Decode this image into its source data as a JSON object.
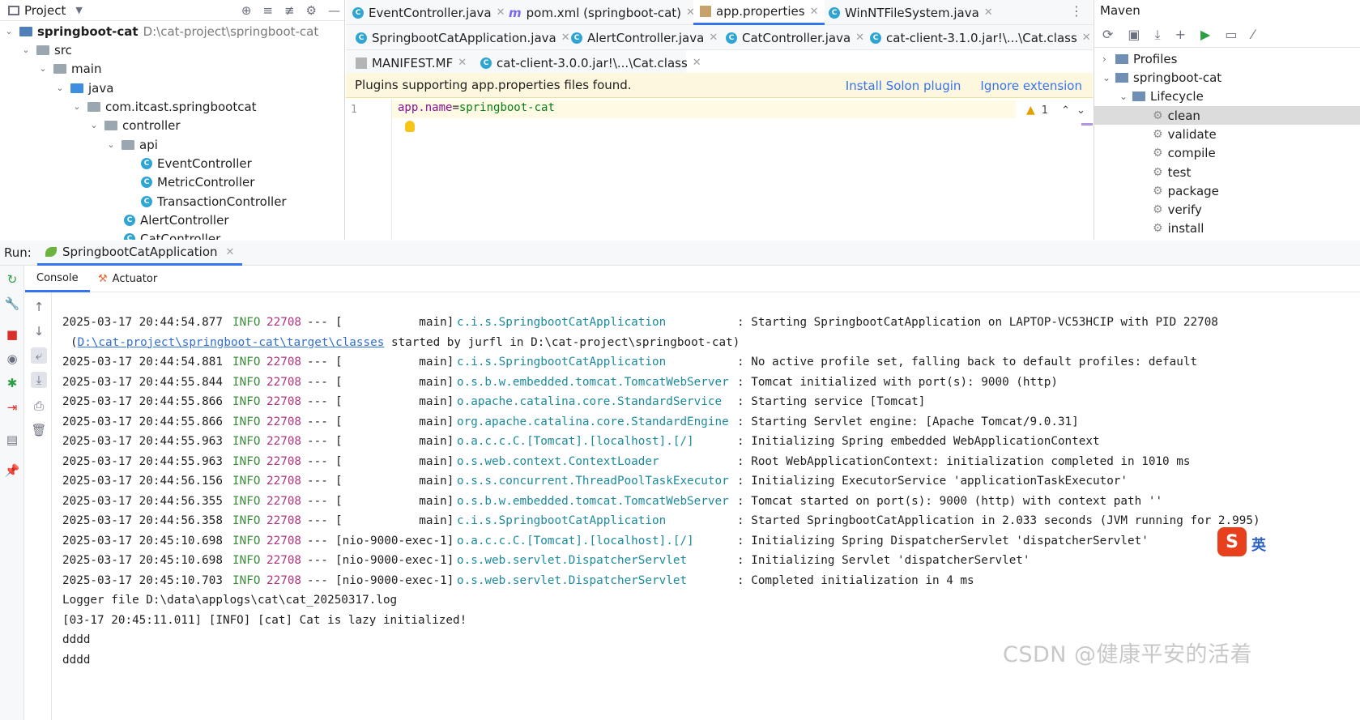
{
  "project": {
    "title": "Project",
    "tree": [
      {
        "label": "springboot-cat",
        "path": "D:\\cat-project\\springboot-cat"
      },
      {
        "label": "src"
      },
      {
        "label": "main"
      },
      {
        "label": "java"
      },
      {
        "label": "com.itcast.springbootcat"
      },
      {
        "label": "controller"
      },
      {
        "label": "api"
      },
      {
        "label": "EventController"
      },
      {
        "label": "MetricController"
      },
      {
        "label": "TransactionController"
      },
      {
        "label": "AlertController"
      },
      {
        "label": "CatController"
      }
    ]
  },
  "editor": {
    "tabs_row1": [
      {
        "label": "EventController.java"
      },
      {
        "label": "pom.xml (springboot-cat)"
      },
      {
        "label": "app.properties"
      },
      {
        "label": "WinNTFileSystem.java"
      }
    ],
    "tabs_row2": [
      {
        "label": "SpringbootCatApplication.java"
      },
      {
        "label": "AlertController.java"
      },
      {
        "label": "CatController.java"
      },
      {
        "label": "cat-client-3.1.0.jar!\\...\\Cat.class"
      }
    ],
    "tabs_row3": [
      {
        "label": "MANIFEST.MF"
      },
      {
        "label": "cat-client-3.0.0.jar!\\...\\Cat.class"
      }
    ],
    "notification": {
      "text": "Plugins supporting app.properties files found.",
      "install_link": "Install Solon plugin",
      "ignore_link": "Ignore extension"
    },
    "line_number": "1",
    "code": {
      "key": "app.name",
      "eq": "=",
      "value": "springboot-cat"
    },
    "warning_count": "1"
  },
  "maven": {
    "title": "Maven",
    "items": [
      {
        "label": "Profiles"
      },
      {
        "label": "springboot-cat"
      },
      {
        "label": "Lifecycle"
      },
      {
        "label": "clean"
      },
      {
        "label": "validate"
      },
      {
        "label": "compile"
      },
      {
        "label": "test"
      },
      {
        "label": "package"
      },
      {
        "label": "verify"
      },
      {
        "label": "install"
      }
    ]
  },
  "run": {
    "label": "Run:",
    "config": "SpringbootCatApplication",
    "tabs": {
      "console": "Console",
      "actuator": "Actuator"
    }
  },
  "console": {
    "lines": [
      {
        "ts": "2025-03-17 20:44:54.877",
        "lvl": "INFO",
        "pid": "22708",
        "dash": "---",
        "thread": "[           main]",
        "logger": "c.i.s.SpringbootCatApplication",
        "msg": ": Starting SpringbootCatApplication on LAPTOP-VC53HCIP with PID 22708"
      },
      {
        "cont_pre": "(",
        "cont_link": "D:\\cat-project\\springboot-cat\\target\\classes",
        "cont_post": " started by jurfl in D:\\cat-project\\springboot-cat)"
      },
      {
        "ts": "2025-03-17 20:44:54.881",
        "lvl": "INFO",
        "pid": "22708",
        "dash": "---",
        "thread": "[           main]",
        "logger": "c.i.s.SpringbootCatApplication",
        "msg": ": No active profile set, falling back to default profiles: default"
      },
      {
        "ts": "2025-03-17 20:44:55.844",
        "lvl": "INFO",
        "pid": "22708",
        "dash": "---",
        "thread": "[           main]",
        "logger": "o.s.b.w.embedded.tomcat.TomcatWebServer",
        "msg": ": Tomcat initialized with port(s): 9000 (http)"
      },
      {
        "ts": "2025-03-17 20:44:55.866",
        "lvl": "INFO",
        "pid": "22708",
        "dash": "---",
        "thread": "[           main]",
        "logger": "o.apache.catalina.core.StandardService",
        "msg": ": Starting service [Tomcat]"
      },
      {
        "ts": "2025-03-17 20:44:55.866",
        "lvl": "INFO",
        "pid": "22708",
        "dash": "---",
        "thread": "[           main]",
        "logger": "org.apache.catalina.core.StandardEngine",
        "msg": ": Starting Servlet engine: [Apache Tomcat/9.0.31]"
      },
      {
        "ts": "2025-03-17 20:44:55.963",
        "lvl": "INFO",
        "pid": "22708",
        "dash": "---",
        "thread": "[           main]",
        "logger": "o.a.c.c.C.[Tomcat].[localhost].[/]",
        "msg": ": Initializing Spring embedded WebApplicationContext"
      },
      {
        "ts": "2025-03-17 20:44:55.963",
        "lvl": "INFO",
        "pid": "22708",
        "dash": "---",
        "thread": "[           main]",
        "logger": "o.s.web.context.ContextLoader",
        "msg": ": Root WebApplicationContext: initialization completed in 1010 ms"
      },
      {
        "ts": "2025-03-17 20:44:56.156",
        "lvl": "INFO",
        "pid": "22708",
        "dash": "---",
        "thread": "[           main]",
        "logger": "o.s.s.concurrent.ThreadPoolTaskExecutor",
        "msg": ": Initializing ExecutorService 'applicationTaskExecutor'"
      },
      {
        "ts": "2025-03-17 20:44:56.355",
        "lvl": "INFO",
        "pid": "22708",
        "dash": "---",
        "thread": "[           main]",
        "logger": "o.s.b.w.embedded.tomcat.TomcatWebServer",
        "msg": ": Tomcat started on port(s): 9000 (http) with context path ''"
      },
      {
        "ts": "2025-03-17 20:44:56.358",
        "lvl": "INFO",
        "pid": "22708",
        "dash": "---",
        "thread": "[           main]",
        "logger": "c.i.s.SpringbootCatApplication",
        "msg": ": Started SpringbootCatApplication in 2.033 seconds (JVM running for 2.995)"
      },
      {
        "ts": "2025-03-17 20:45:10.698",
        "lvl": "INFO",
        "pid": "22708",
        "dash": "---",
        "thread": "[nio-9000-exec-1]",
        "logger": "o.a.c.c.C.[Tomcat].[localhost].[/]",
        "msg": ": Initializing Spring DispatcherServlet 'dispatcherServlet'"
      },
      {
        "ts": "2025-03-17 20:45:10.698",
        "lvl": "INFO",
        "pid": "22708",
        "dash": "---",
        "thread": "[nio-9000-exec-1]",
        "logger": "o.s.web.servlet.DispatcherServlet",
        "msg": ": Initializing Servlet 'dispatcherServlet'"
      },
      {
        "ts": "2025-03-17 20:45:10.703",
        "lvl": "INFO",
        "pid": "22708",
        "dash": "---",
        "thread": "[nio-9000-exec-1]",
        "logger": "o.s.web.servlet.DispatcherServlet",
        "msg": ": Completed initialization in 4 ms"
      },
      {
        "plain": "Logger file D:\\data\\applogs\\cat\\cat_20250317.log"
      },
      {
        "plain": "[03-17 20:45:11.011] [INFO] [cat] Cat is lazy initialized!"
      },
      {
        "plain": "dddd"
      },
      {
        "plain": "dddd"
      }
    ]
  },
  "watermark": "CSDN @健康平安的活着",
  "ime": {
    "badge": "S",
    "lang": "英"
  },
  "colors": {
    "accent": "#3574f0",
    "info": "#3a8c3a",
    "pid": "#b0357d",
    "logger": "#1c8a9c",
    "notify_bg": "#fdf7dd"
  }
}
